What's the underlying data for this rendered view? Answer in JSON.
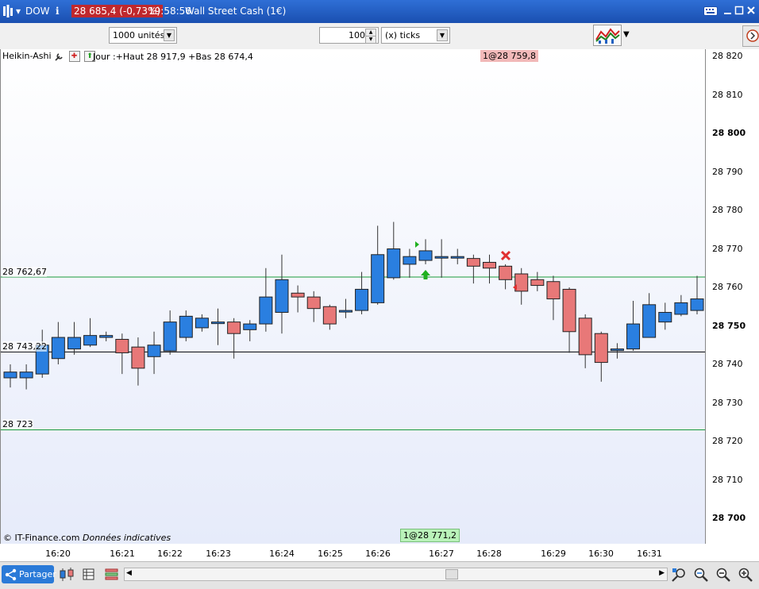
{
  "titlebar": {
    "symbol": "DOW",
    "info_icon": "i",
    "price_change": "28 685,4 (-0,73%)",
    "time": "19:58:56",
    "instrument": "Wall Street Cash (1€)"
  },
  "toolbar": {
    "units": "1000 unités",
    "tick_count": "100",
    "tick_type": "(x) ticks"
  },
  "chart": {
    "indicator_name": "Heikin-Ashi",
    "day_info": "Jour :+Haut 28 917,9 +Bas 28 674,4",
    "order_top": "1@28 759,8",
    "order_bottom": "1@28 771,2",
    "level_upper": "28 762,67",
    "level_mid": "28 743,22",
    "level_lower": "28 723",
    "copyright": "© IT-Finance.com",
    "disclaimer": "Données indicatives",
    "colors": {
      "up": "#2a7fe0",
      "down": "#e87878",
      "level_green": "#1a9a3a",
      "level_black": "#000000"
    }
  },
  "yaxis": {
    "ticks": [
      "28 820",
      "28 810",
      "28 800",
      "28 790",
      "28 780",
      "28 770",
      "28 760",
      "28 750",
      "28 740",
      "28 730",
      "28 720",
      "28 710",
      "28 700"
    ]
  },
  "xaxis": {
    "ticks": [
      "16:20",
      "16:21",
      "16:22",
      "16:23",
      "16:24",
      "16:25",
      "16:26",
      "16:27",
      "16:28",
      "16:29",
      "16:30",
      "16:31"
    ]
  },
  "bottombar": {
    "share_label": "Partager"
  },
  "chart_data": {
    "type": "candlestick",
    "ylim": [
      28700,
      28820
    ],
    "levels": [
      28762.67,
      28743.22,
      28723
    ],
    "candles": [
      [
        28736.5,
        28738,
        28740,
        28734
      ],
      [
        28736.5,
        28738,
        28740,
        28733.5
      ],
      [
        28737.5,
        28745,
        28749,
        28736.5
      ],
      [
        28741.5,
        28747,
        28751,
        28740
      ],
      [
        28744,
        28747,
        28751,
        28742.5
      ],
      [
        28745,
        28747.5,
        28752,
        28744.5
      ],
      [
        28747,
        28747.5,
        28748.5,
        28746
      ],
      [
        28746.5,
        28743,
        28748,
        28737.5
      ],
      [
        28744.5,
        28739,
        28747,
        28734.5
      ],
      [
        28742,
        28745,
        28748.5,
        28737.5
      ],
      [
        28743.5,
        28751,
        28754,
        28742.5
      ],
      [
        28747,
        28752.5,
        28754,
        28746
      ],
      [
        28749.5,
        28752,
        28753,
        28748.5
      ],
      [
        28751,
        28751,
        28754.5,
        28745
      ],
      [
        28751,
        28748,
        28752,
        28741.5
      ],
      [
        28749,
        28750.5,
        28751.5,
        28746
      ],
      [
        28750.5,
        28757.5,
        28765,
        28748.5
      ],
      [
        28753.5,
        28762,
        28768.5,
        28748
      ],
      [
        28758.5,
        28757.5,
        28760.5,
        28753.5
      ],
      [
        28757.5,
        28754.5,
        28759,
        28751
      ],
      [
        28755,
        28750.5,
        28755.5,
        28749
      ],
      [
        28754,
        28754,
        28757,
        28752
      ],
      [
        28754,
        28759.5,
        28764,
        28753
      ],
      [
        28756,
        28768.5,
        28776,
        28755.5
      ],
      [
        28762.5,
        28770,
        28777,
        28762
      ],
      [
        28766,
        28768,
        28770,
        28762.5
      ],
      [
        28767,
        28769.5,
        28772.5,
        28766
      ],
      [
        28768,
        28768,
        28772.5,
        28762.5
      ],
      [
        28768,
        28768,
        28770,
        28766
      ],
      [
        28767.5,
        28765.5,
        28768.5,
        28761
      ],
      [
        28766.5,
        28765,
        28768.5,
        28761
      ],
      [
        28765.5,
        28762,
        28766,
        28759.5
      ],
      [
        28763.5,
        28759,
        28765,
        28755.5
      ],
      [
        28762,
        28760.5,
        28764,
        28759
      ],
      [
        28761.5,
        28757,
        28763,
        28751.5
      ],
      [
        28759.5,
        28748.5,
        28760,
        28743
      ],
      [
        28752,
        28742.5,
        28753,
        28739
      ],
      [
        28748,
        28740.5,
        28748.5,
        28735.5
      ],
      [
        28744,
        28744,
        28745.5,
        28741.5
      ],
      [
        28744,
        28750.5,
        28756.5,
        28743.5
      ],
      [
        28747,
        28755.5,
        28758.5,
        28747
      ],
      [
        28751,
        28753.5,
        28756,
        28749
      ],
      [
        28753,
        28756,
        28758,
        28752.5
      ],
      [
        28754,
        28757,
        28763,
        28753
      ]
    ]
  }
}
